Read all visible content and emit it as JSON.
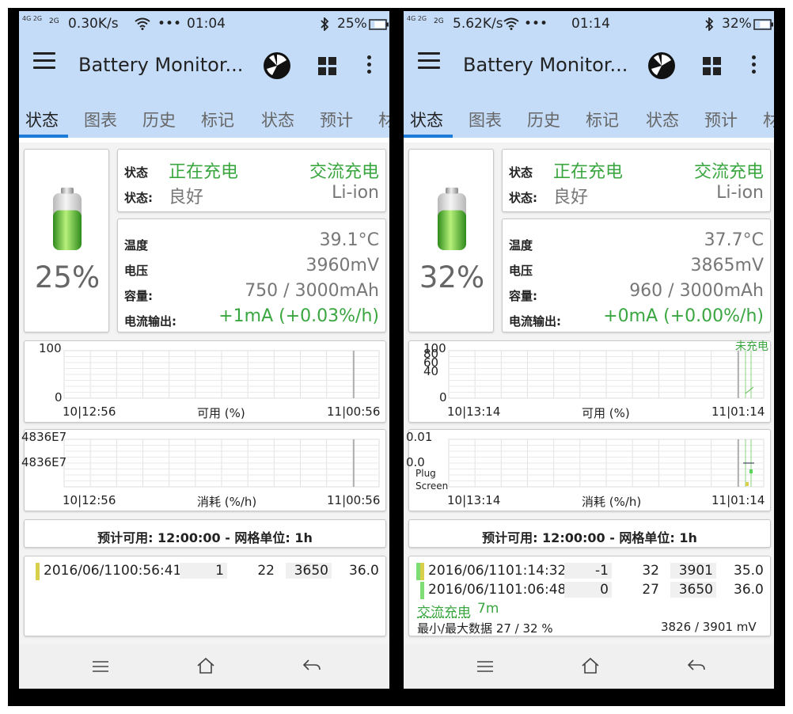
{
  "colors": {
    "accent": "#1a7bd8",
    "appbar": "#c5dcf9",
    "green": "#3aa640",
    "bar_yellow": "#d8d04a",
    "bar_green": "#7ddc74"
  },
  "phones": [
    {
      "status": {
        "net": "4G 2G",
        "net2": "2G",
        "speed": "0.30K/s",
        "dots": "•••",
        "time": "01:04",
        "battery": "25%"
      },
      "app_title": "Battery Monitor...",
      "tabs": [
        "状态",
        "图表",
        "历史",
        "标记",
        "状态",
        "预计",
        "材"
      ],
      "battery_pct": "25%",
      "battery_level": 0.25,
      "state1_label": "状态",
      "state1_val": "正在充电",
      "state1_val2": "交流充电",
      "state2_label": "状态:",
      "state2_val": "良好",
      "state2_val2": "Li-ion",
      "temp_label": "温度",
      "temp_val": "39.1°C",
      "volt_label": "电压",
      "volt_val": "3960mV",
      "cap_label": "容量:",
      "cap_val": "750 / 3000mAh",
      "cur_label": "电流输出:",
      "cur_val": "+1mA (+0.03%/h)",
      "chart1": {
        "y_top": "100",
        "y_bottom": "0",
        "x_left": "10|12:56",
        "x_mid": "可用 (%)",
        "x_right": "11|00:56",
        "note": "",
        "ylabels": []
      },
      "chart2": {
        "y_top": "4836E7",
        "y_bottom": "4836E7",
        "x_left": "10|12:56",
        "x_mid": "消耗 (%/h)",
        "x_right": "11|00:56",
        "plug": "",
        "screen": ""
      },
      "estimate": "预计可用: 12:00:00 - 网格单位:   1h",
      "history": [
        {
          "date": "2016/06/11",
          "time": "00:56:41",
          "delta": "1",
          "pct": "22",
          "mv": "3650",
          "temp": "36.0",
          "bar": "yellow"
        }
      ],
      "extra1": "",
      "extra1b": "",
      "extra2": "",
      "extra2b": ""
    },
    {
      "status": {
        "net": "4G 2G",
        "net2": "2G",
        "speed": "5.62K/s",
        "dots": "•••",
        "time": "01:14",
        "battery": "32%"
      },
      "app_title": "Battery Monitor...",
      "tabs": [
        "状态",
        "图表",
        "历史",
        "标记",
        "状态",
        "预计",
        "材"
      ],
      "battery_pct": "32%",
      "battery_level": 0.32,
      "state1_label": "状态",
      "state1_val": "正在充电",
      "state1_val2": "交流充电",
      "state2_label": "状态:",
      "state2_val": "良好",
      "state2_val2": "Li-ion",
      "temp_label": "温度",
      "temp_val": "37.7°C",
      "volt_label": "电压",
      "volt_val": "3865mV",
      "cap_label": "容量:",
      "cap_val": "960 / 3000mAh",
      "cur_label": "电流输出:",
      "cur_val": "+0mA (+0.00%/h)",
      "chart1": {
        "y_top": "100",
        "y_bottom": "0",
        "x_left": "10|13:14",
        "x_mid": "可用 (%)",
        "x_right": "11|01:14",
        "note": "未充电",
        "ylabels": [
          "80",
          "60",
          "40"
        ]
      },
      "chart2": {
        "y_top": "0.01",
        "y_bottom": "0.0",
        "x_left": "10|13:14",
        "x_mid": "消耗 (%/h)",
        "x_right": "11|01:14",
        "plug": "Plug",
        "screen": "Screen"
      },
      "estimate": "预计可用: 12:00:00 - 网格单位:   1h",
      "history": [
        {
          "date": "2016/06/11",
          "time": "01:14:32",
          "delta": "-1",
          "pct": "32",
          "mv": "3901",
          "temp": "35.0",
          "bar": "mixed"
        },
        {
          "date": "2016/06/11",
          "time": "01:06:48",
          "delta": "0",
          "pct": "27",
          "mv": "3650",
          "temp": "36.0",
          "bar": "green"
        }
      ],
      "extra1": "交流充电",
      "extra1b": "7m",
      "extra2": "最小/最大数据 27 / 32 %",
      "extra2b": "3826 / 3901 mV"
    }
  ]
}
